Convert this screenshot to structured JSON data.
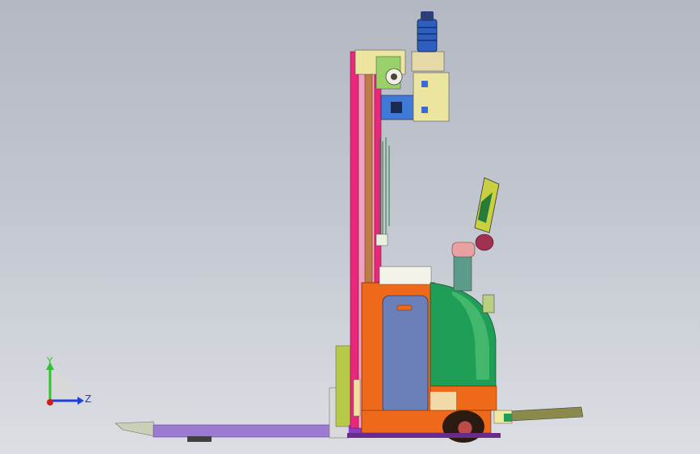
{
  "viewport": {
    "background_top": "#b3b8c2",
    "background_bottom": "#dcdee3"
  },
  "triad": {
    "y_label": "Y",
    "z_label": "Z",
    "y_color": "#2cc52c",
    "z_color": "#1f3fd8",
    "origin_color": "#d41c1c"
  },
  "model": {
    "mast_color": "#e8287a",
    "cylinder_color": "#c07a4a",
    "body_color": "#ee6a1a",
    "cover_color": "#1f9e57",
    "panel_color": "#6b7fb8",
    "fork_color": "#9c7ad2",
    "motor_color": "#2c3f7a",
    "box_color": "#ece5a0"
  }
}
